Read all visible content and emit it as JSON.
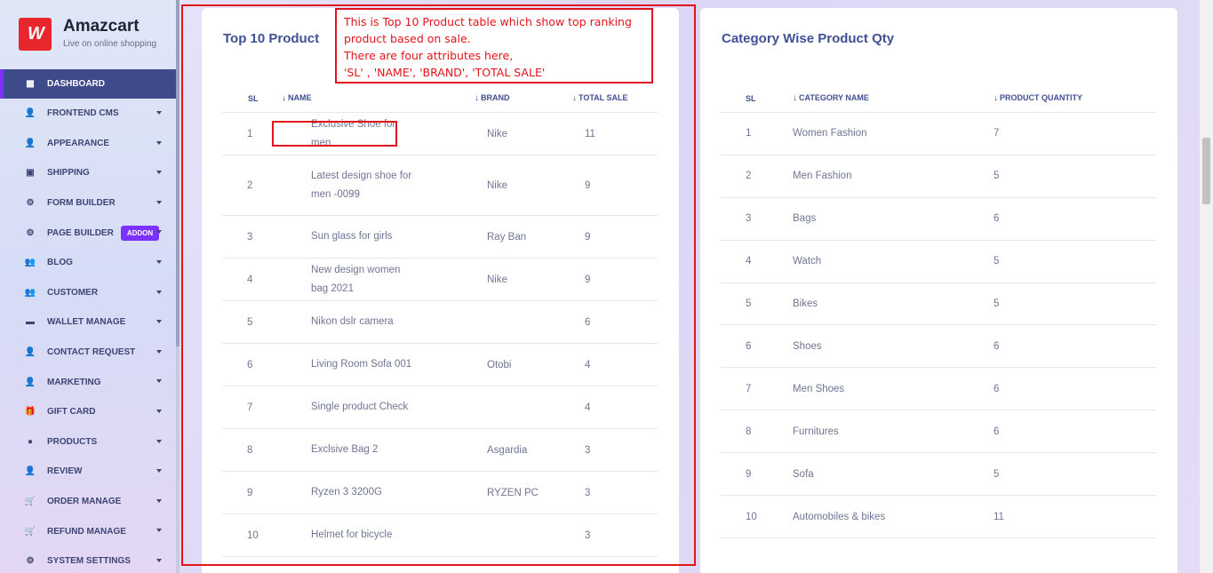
{
  "brand": {
    "name": "Amazcart",
    "tagline": "Live on online shopping",
    "logo_text": "W"
  },
  "sidebar": {
    "items": [
      {
        "label": "DASHBOARD",
        "icon": "grid-icon",
        "glyph": "▦",
        "active": true,
        "caret": false
      },
      {
        "label": "FRONTEND CMS",
        "icon": "user-icon",
        "glyph": "👤",
        "caret": true
      },
      {
        "label": "APPEARANCE",
        "icon": "user-icon",
        "glyph": "👤",
        "caret": true
      },
      {
        "label": "SHIPPING",
        "icon": "money-icon",
        "glyph": "▣",
        "caret": true
      },
      {
        "label": "FORM BUILDER",
        "icon": "gears-icon",
        "glyph": "⚙",
        "caret": true
      },
      {
        "label": "PAGE BUILDER",
        "icon": "gears-icon",
        "glyph": "⚙",
        "caret": true,
        "badge": "ADDON"
      },
      {
        "label": "BLOG",
        "icon": "users-icon",
        "glyph": "👥",
        "caret": true
      },
      {
        "label": "CUSTOMER",
        "icon": "users-icon",
        "glyph": "👥",
        "caret": true
      },
      {
        "label": "WALLET MANAGE",
        "icon": "wallet-icon",
        "glyph": "▬",
        "caret": true
      },
      {
        "label": "CONTACT REQUEST",
        "icon": "user-icon",
        "glyph": "👤",
        "caret": true
      },
      {
        "label": "MARKETING",
        "icon": "user-icon",
        "glyph": "👤",
        "caret": true
      },
      {
        "label": "GIFT CARD",
        "icon": "gift-icon",
        "glyph": "🎁",
        "caret": true
      },
      {
        "label": "PRODUCTS",
        "icon": "product-icon",
        "glyph": "●",
        "caret": true
      },
      {
        "label": "REVIEW",
        "icon": "user-icon",
        "glyph": "👤",
        "caret": true
      },
      {
        "label": "ORDER MANAGE",
        "icon": "cart-icon",
        "glyph": "🛒",
        "caret": true
      },
      {
        "label": "REFUND MANAGE",
        "icon": "cart-icon",
        "glyph": "🛒",
        "caret": true
      },
      {
        "label": "SYSTEM SETTINGS",
        "icon": "gear-icon",
        "glyph": "⚙",
        "caret": true
      }
    ]
  },
  "top_products": {
    "title": "Top 10 Product",
    "headers": {
      "sl": "SL",
      "name": "NAME",
      "brand": "BRAND",
      "total_sale": "TOTAL SALE"
    },
    "rows": [
      {
        "sl": "1",
        "name": "Exclusive Shoe for men",
        "brand": "Nike",
        "total_sale": "11"
      },
      {
        "sl": "2",
        "name": "Latest design shoe for men -0099",
        "brand": "Nike",
        "total_sale": "9"
      },
      {
        "sl": "3",
        "name": "Sun glass for girls",
        "brand": "Ray Ban",
        "total_sale": "9"
      },
      {
        "sl": "4",
        "name": "New design women bag 2021",
        "brand": "Nike",
        "total_sale": "9"
      },
      {
        "sl": "5",
        "name": "Nikon dslr camera",
        "brand": "",
        "total_sale": "6"
      },
      {
        "sl": "6",
        "name": "Living Room Sofa 001",
        "brand": "Otobi",
        "total_sale": "4"
      },
      {
        "sl": "7",
        "name": "Single product Check",
        "brand": "",
        "total_sale": "4"
      },
      {
        "sl": "8",
        "name": "Exclsive Bag 2",
        "brand": "Asgardia",
        "total_sale": "3"
      },
      {
        "sl": "9",
        "name": "Ryzen 3 3200G",
        "brand": "RYZEN PC",
        "total_sale": "3"
      },
      {
        "sl": "10",
        "name": "Helmet for bicycle",
        "brand": "",
        "total_sale": "3"
      }
    ]
  },
  "category_qty": {
    "title": "Category Wise Product Qty",
    "headers": {
      "sl": "SL",
      "category_name": "CATEGORY NAME",
      "product_quantity": "PRODUCT QUANTITY"
    },
    "rows": [
      {
        "sl": "1",
        "name": "Women Fashion",
        "qty": "7"
      },
      {
        "sl": "2",
        "name": "Men Fashion",
        "qty": "5"
      },
      {
        "sl": "3",
        "name": "Bags",
        "qty": "6"
      },
      {
        "sl": "4",
        "name": "Watch",
        "qty": "5"
      },
      {
        "sl": "5",
        "name": "Bikes",
        "qty": "5"
      },
      {
        "sl": "6",
        "name": "Shoes",
        "qty": "6"
      },
      {
        "sl": "7",
        "name": "Men Shoes",
        "qty": "6"
      },
      {
        "sl": "8",
        "name": "Furnitures",
        "qty": "6"
      },
      {
        "sl": "9",
        "name": "Sofa",
        "qty": "5"
      },
      {
        "sl": "10",
        "name": "Automobiles & bikes",
        "qty": "11"
      }
    ]
  },
  "annotation": {
    "lines": [
      "This is Top 10 Product table which show top ranking",
      "product based on sale.",
      "There are four attributes here,",
      "'SL' , 'NAME', 'BRAND', 'TOTAL SALE'"
    ]
  },
  "colors": {
    "accent": "#7c32ff",
    "active_bg": "#3f4a8a",
    "annotation_red": "#e4141c",
    "heading": "#415094"
  }
}
